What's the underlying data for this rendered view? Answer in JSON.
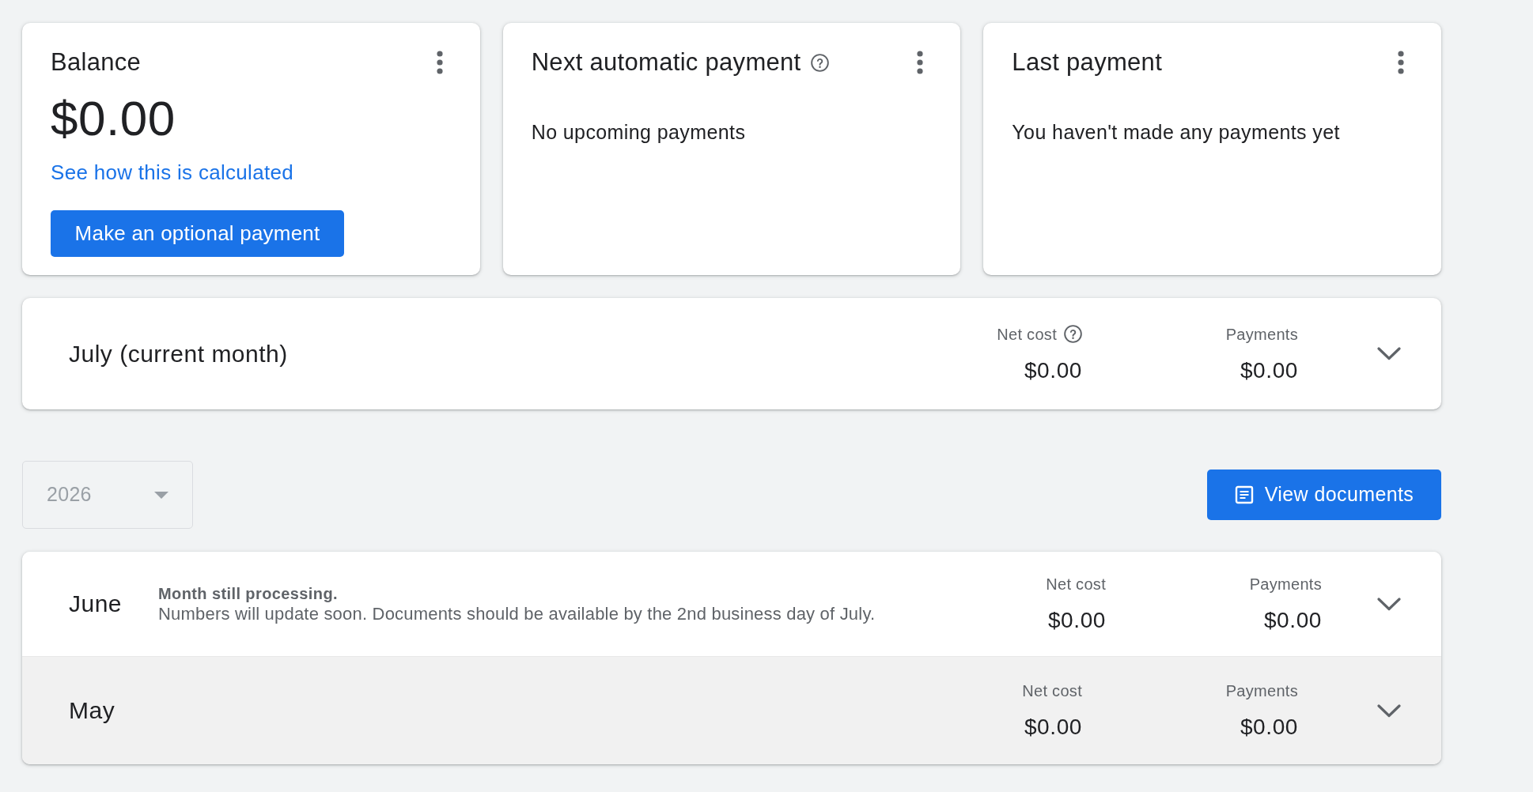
{
  "cards": [
    {
      "title": "Balance",
      "amount": "$0.00",
      "link": "See how this is calculated",
      "button": "Make an optional payment"
    },
    {
      "title": "Next automatic payment",
      "help": true,
      "message": "No upcoming payments"
    },
    {
      "title": "Last payment",
      "message": "You haven't made any payments yet"
    }
  ],
  "current_month": {
    "name": "July (current month)",
    "expanded": false,
    "columns": [
      {
        "label": "Net cost",
        "help": true,
        "value": "$0.00"
      },
      {
        "label": "Payments",
        "value": "$0.00"
      }
    ]
  },
  "year_select": {
    "value": "2026",
    "disabled": true
  },
  "view_documents_button": "View documents",
  "months": [
    {
      "name": "June",
      "note_title": "Month still processing.",
      "note": "Numbers will update soon. Documents should be available by the 2nd business day of July.",
      "highlighted": false,
      "expanded": false,
      "columns": [
        {
          "label": "Net cost",
          "value": "$0.00"
        },
        {
          "label": "Payments",
          "value": "$0.00"
        }
      ]
    },
    {
      "name": "May",
      "highlighted": true,
      "expanded": false,
      "columns": [
        {
          "label": "Net cost",
          "value": "$0.00"
        },
        {
          "label": "Payments",
          "value": "$0.00"
        }
      ]
    }
  ]
}
